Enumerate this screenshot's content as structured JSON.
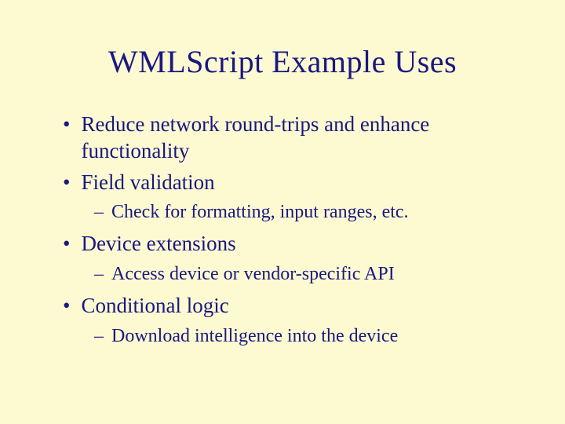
{
  "title": "WMLScript Example Uses",
  "bullets": {
    "b1": "Reduce network round-trips and enhance functionality",
    "b2": "Field validation",
    "b2s1": "Check for formatting, input ranges, etc.",
    "b3": "Device extensions",
    "b3s1": "Access device or vendor-specific API",
    "b4": "Conditional logic",
    "b4s1": "Download intelligence into the device"
  },
  "markers": {
    "l1": "•",
    "l2": "–"
  }
}
